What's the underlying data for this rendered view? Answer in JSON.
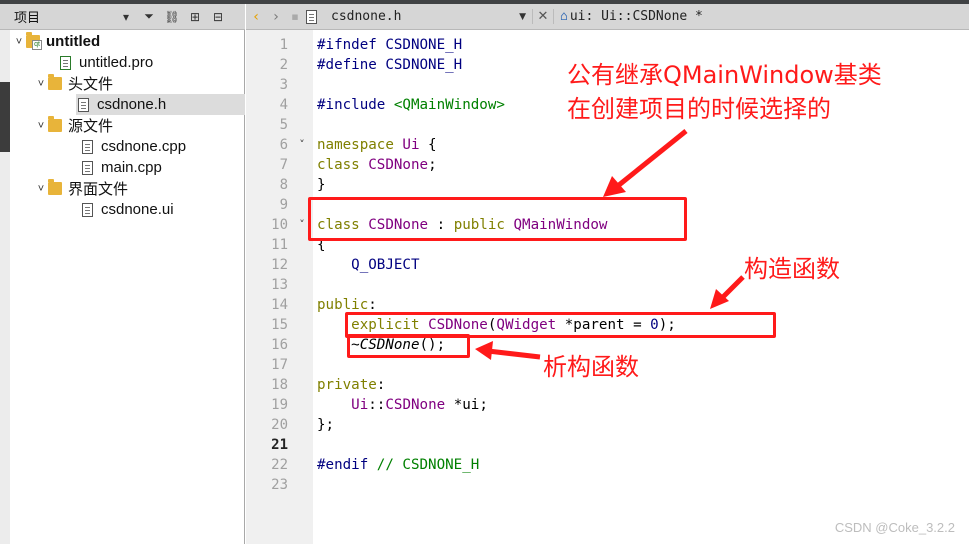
{
  "project_panel": {
    "title": "项目",
    "tree": [
      {
        "label": "untitled",
        "icon": "qt-project-folder-icon",
        "bold": true,
        "expanded": true
      },
      {
        "label": "untitled.pro",
        "icon": "pro-file-icon"
      },
      {
        "label": "头文件",
        "icon": "header-folder-icon",
        "expanded": true
      },
      {
        "label": "csdnone.h",
        "icon": "header-file-icon",
        "selected": true
      },
      {
        "label": "源文件",
        "icon": "source-folder-icon",
        "expanded": true
      },
      {
        "label": "csdnone.cpp",
        "icon": "cpp-file-icon"
      },
      {
        "label": "main.cpp",
        "icon": "cpp-file-icon"
      },
      {
        "label": "界面文件",
        "icon": "forms-folder-icon",
        "expanded": true
      },
      {
        "label": "csdnone.ui",
        "icon": "ui-file-icon"
      }
    ]
  },
  "editor": {
    "file_name": "csdnone.h",
    "symbol": "ui: Ui::CSDNone *",
    "current_line": "21",
    "line_numbers": [
      "1",
      "2",
      "3",
      "4",
      "5",
      "6",
      "7",
      "8",
      "9",
      "10",
      "11",
      "12",
      "13",
      "14",
      "15",
      "16",
      "17",
      "18",
      "19",
      "20",
      "21",
      "22",
      "23"
    ],
    "fold_markers": [
      "˅",
      "˅"
    ]
  },
  "annotations": {
    "base_class_note_line1": "公有继承QMainWindow基类",
    "base_class_note_line2": "在创建项目的时候选择的",
    "constructor_note": "构造函数",
    "destructor_note": "析构函数"
  },
  "watermark": "CSDN @Coke_3.2.2",
  "colors": {
    "annotation_red": "#ff1a1a",
    "keyword": "#808000",
    "type": "#800080",
    "preprocessor": "#000080",
    "comment": "#008000"
  }
}
